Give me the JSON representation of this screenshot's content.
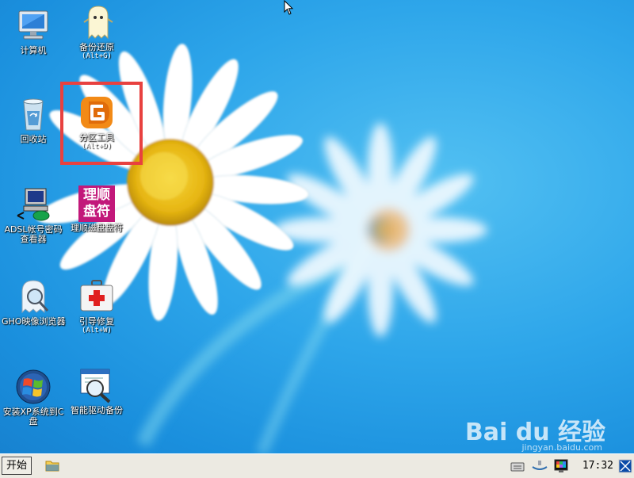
{
  "desktop": {
    "icons": [
      {
        "label": "计算机",
        "hotkey": ""
      },
      {
        "label": "备份还原",
        "hotkey": "(Alt+G)"
      },
      {
        "label": "回收站",
        "hotkey": ""
      },
      {
        "label": "分区工具",
        "hotkey": "(Alt+D)"
      },
      {
        "label": "ADSL帐号密码查看器",
        "hotkey": ""
      },
      {
        "label": "理顺磁盘盘符",
        "hotkey": ""
      },
      {
        "label": "GHO映像浏览器",
        "hotkey": ""
      },
      {
        "label": "引导修复",
        "hotkey": "(Alt+W)"
      },
      {
        "label": "安装XP系统到C盘",
        "hotkey": ""
      },
      {
        "label": "智能驱动备份",
        "hotkey": ""
      }
    ],
    "lishun_icon_text": [
      "理顺",
      "盘符"
    ],
    "highlight_color": "#e8413f"
  },
  "watermark": {
    "text": "Bai du 经验",
    "subtext": "jingyan.baidu.com"
  },
  "taskbar": {
    "start_label": "开始",
    "clock": "17:32"
  }
}
